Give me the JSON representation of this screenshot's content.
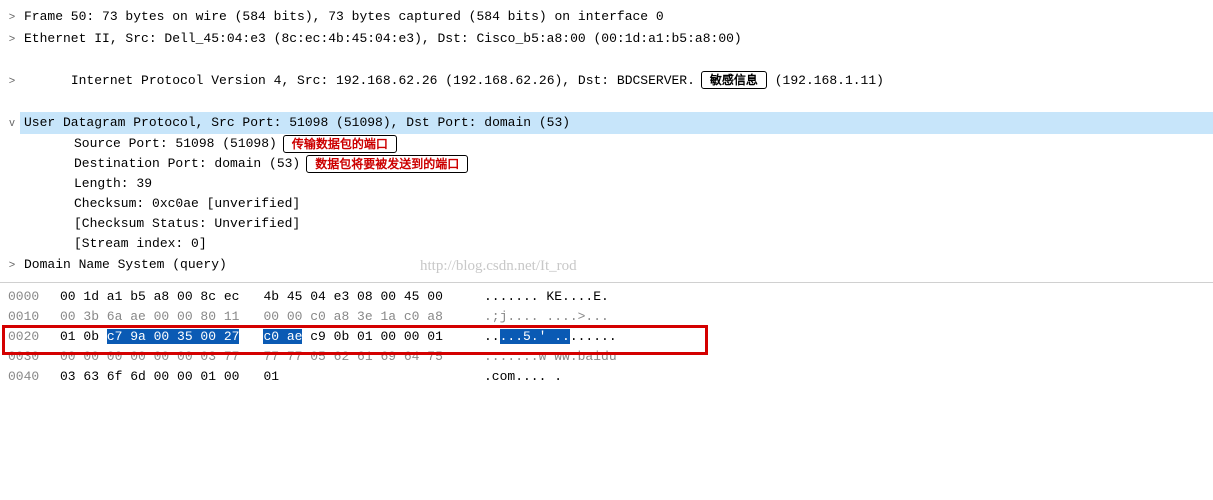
{
  "tree": {
    "frame": {
      "chev": ">",
      "text": "Frame 50: 73 bytes on wire (584 bits), 73 bytes captured (584 bits) on interface 0"
    },
    "eth": {
      "chev": ">",
      "text": "Ethernet II, Src: Dell_45:04:e3 (8c:ec:4b:45:04:e3), Dst: Cisco_b5:a8:00 (00:1d:a1:b5:a8:00)"
    },
    "ip": {
      "chev": ">",
      "text_pre": "Internet Protocol Version 4, Src: 192.168.62.26 (192.168.62.26), Dst: BDCSERVER.",
      "annot": "敏感信息",
      "text_post": " (192.168.1.11)"
    },
    "udp": {
      "chev": "v",
      "text": "User Datagram Protocol, Src Port: 51098 (51098), Dst Port: domain (53)",
      "srcport": {
        "text": "Source Port: 51098 (51098)",
        "annot": "传输数据包的端口"
      },
      "dstport": {
        "text": "Destination Port: domain (53)",
        "annot": "数据包将要被发送到的端口"
      },
      "length": "Length: 39",
      "checksum": "Checksum: 0xc0ae [unverified]",
      "chkstatus": "[Checksum Status: Unverified]",
      "streamidx": "[Stream index: 0]"
    },
    "dns": {
      "chev": ">",
      "text": "Domain Name System (query)"
    }
  },
  "hex": {
    "rows": [
      {
        "offset": "0000",
        "b1": "00 1d a1 b5 a8 00 8c ec",
        "b2": "4b 45 04 e3 08 00 45 00",
        "ascii": "....... KE....E."
      },
      {
        "offset": "0010",
        "b1": "00 3b 6a ae 00 00 80 11",
        "b2": "00 00 c0 a8 3e 1a c0 a8",
        "ascii": ".;j.... ....>..."
      },
      {
        "offset": "0020",
        "b1_pre": "01 0b ",
        "b1_hl": "c7 9a 00 35 00 27",
        "b2_hl": "c0 ae",
        "b2_post": " c9 0b 01 00 00 01",
        "ascii_pre": "..",
        "ascii_hl": "...5.' ..",
        "ascii_post": "......"
      },
      {
        "offset": "0030",
        "b1": "00 00 00 00 00 00 03 77",
        "b2": "77 77 05 62 61 69 64 75",
        "ascii": ".......w ww.baidu"
      },
      {
        "offset": "0040",
        "b1": "03 63 6f 6d 00 00 01 00",
        "b2": "01",
        "ascii": ".com.... ."
      }
    ]
  },
  "watermark": "http://blog.csdn.net/It_rod"
}
